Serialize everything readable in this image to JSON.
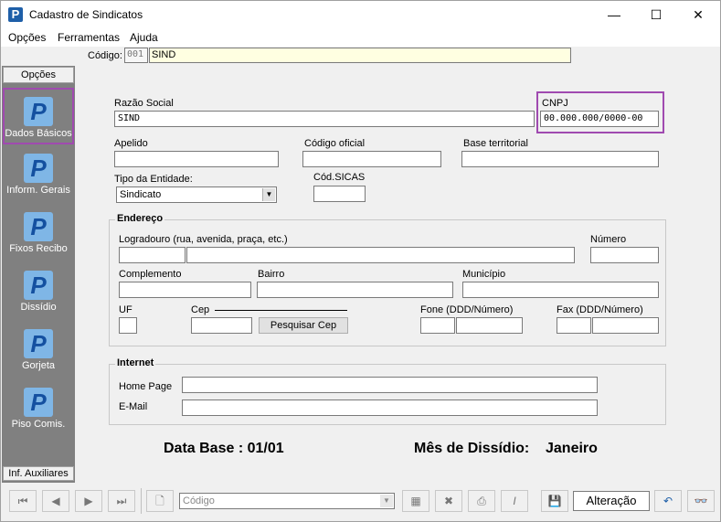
{
  "window": {
    "title": "Cadastro de Sindicatos",
    "app_icon_glyph": "P",
    "minimize": "—",
    "maximize": "☐",
    "close": "✕"
  },
  "menu": [
    "Opções",
    "Ferramentas",
    "Ajuda"
  ],
  "code_bar": {
    "label": "Código:",
    "number": "001",
    "name": "SIND"
  },
  "sidebar": {
    "header": "Opções",
    "items": [
      {
        "label": "Dados Básicos",
        "icon": "p-icon"
      },
      {
        "label": "Inform. Gerais",
        "icon": "p-icon"
      },
      {
        "label": "Fixos Recibo",
        "icon": "p-icon"
      },
      {
        "label": "Dissídio",
        "icon": "p-icon"
      },
      {
        "label": "Gorjeta",
        "icon": "p-icon"
      },
      {
        "label": "Piso Comis.",
        "icon": "p-icon"
      }
    ],
    "footer": "Inf. Auxiliares"
  },
  "form": {
    "razao_social_label": "Razão Social",
    "razao_social": "SIND",
    "cnpj_label": "CNPJ",
    "cnpj_placeholder": "00.000.000/0000-00",
    "apelido_label": "Apelido",
    "codigo_oficial_label": "Código oficial",
    "base_territorial_label": "Base territorial",
    "tipo_entidade_label": "Tipo da Entidade:",
    "tipo_entidade_value": "Sindicato",
    "cod_sicas_label": "Cód.SICAS",
    "endereco_title": "Endereço",
    "logradouro_label": "Logradouro (rua, avenida, praça, etc.)",
    "numero_label": "Número",
    "complemento_label": "Complemento",
    "bairro_label": "Bairro",
    "municipio_label": "Município",
    "uf_label": "UF",
    "cep_label": "Cep",
    "pesquisar_cep": "Pesquisar Cep",
    "fone_label": "Fone (DDD/Número)",
    "fax_label": "Fax (DDD/Número)",
    "internet_title": "Internet",
    "home_page_label": "Home Page",
    "email_label": "E-Mail",
    "data_base": "Data Base : 01/01",
    "mes_dissidio_label": "Mês de Dissídio:",
    "mes_dissidio_value": "Janeiro"
  },
  "toolbar": {
    "search_placeholder": "Código",
    "mode": "Alteração"
  },
  "colors": {
    "highlight": "#a04ab0",
    "sidebar_bg": "#808080",
    "code_bg": "#ffffe1"
  }
}
